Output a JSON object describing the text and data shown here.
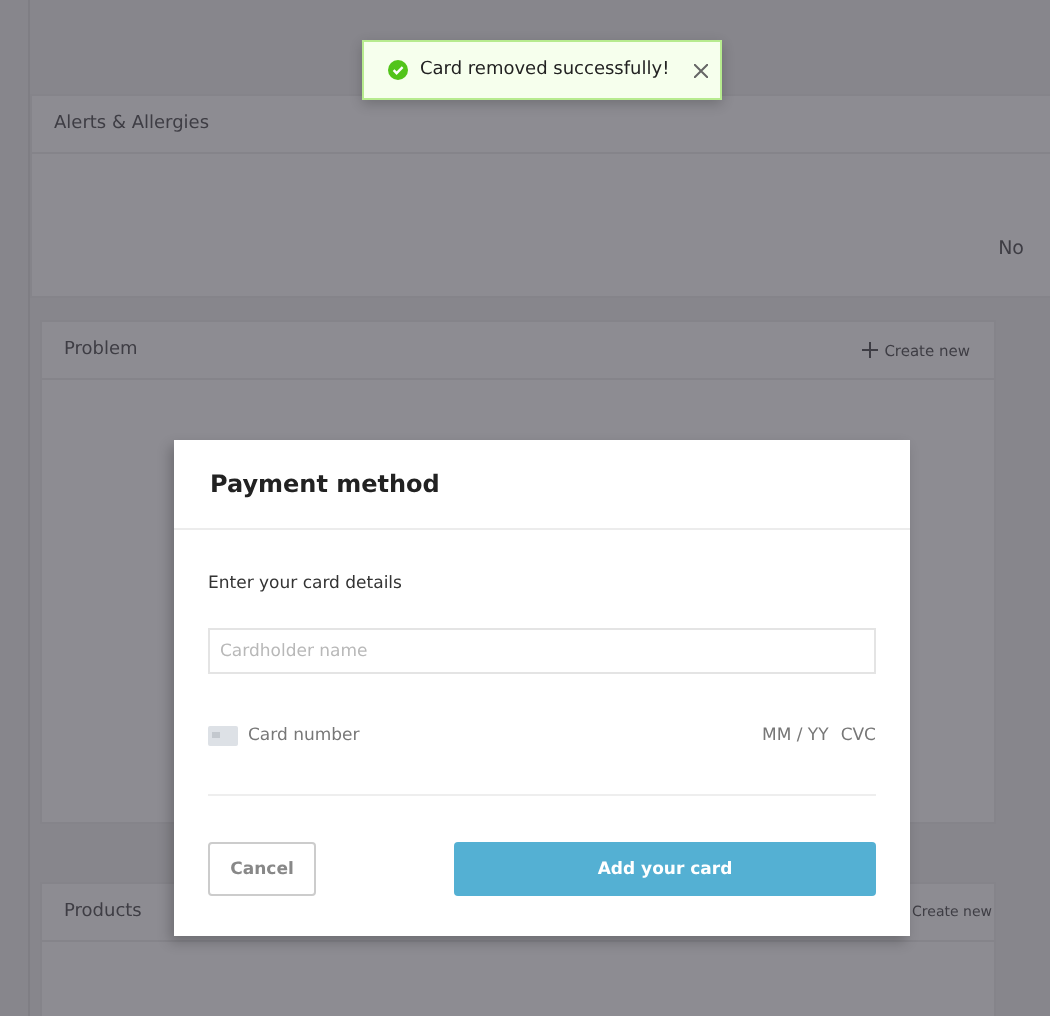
{
  "toast": {
    "message": "Card removed successfully!",
    "kind": "success"
  },
  "panels": [
    {
      "title": "Alerts & Allergies",
      "body_text": "No"
    },
    {
      "title": "Problem",
      "action": "Create new"
    },
    {
      "title": "Products",
      "action": "Create new"
    }
  ],
  "modal": {
    "title": "Payment method",
    "subtitle": "Enter your card details",
    "name_field": {
      "placeholder": "Cardholder name"
    },
    "card_number": {
      "placeholder": "Card number"
    },
    "expiry": {
      "placeholder": "MM / YY"
    },
    "cvc": {
      "placeholder": "CVC"
    },
    "buttons": [
      {
        "label": "Cancel",
        "kind": "secondary"
      },
      {
        "label": "Add your card",
        "kind": "primary"
      }
    ]
  }
}
